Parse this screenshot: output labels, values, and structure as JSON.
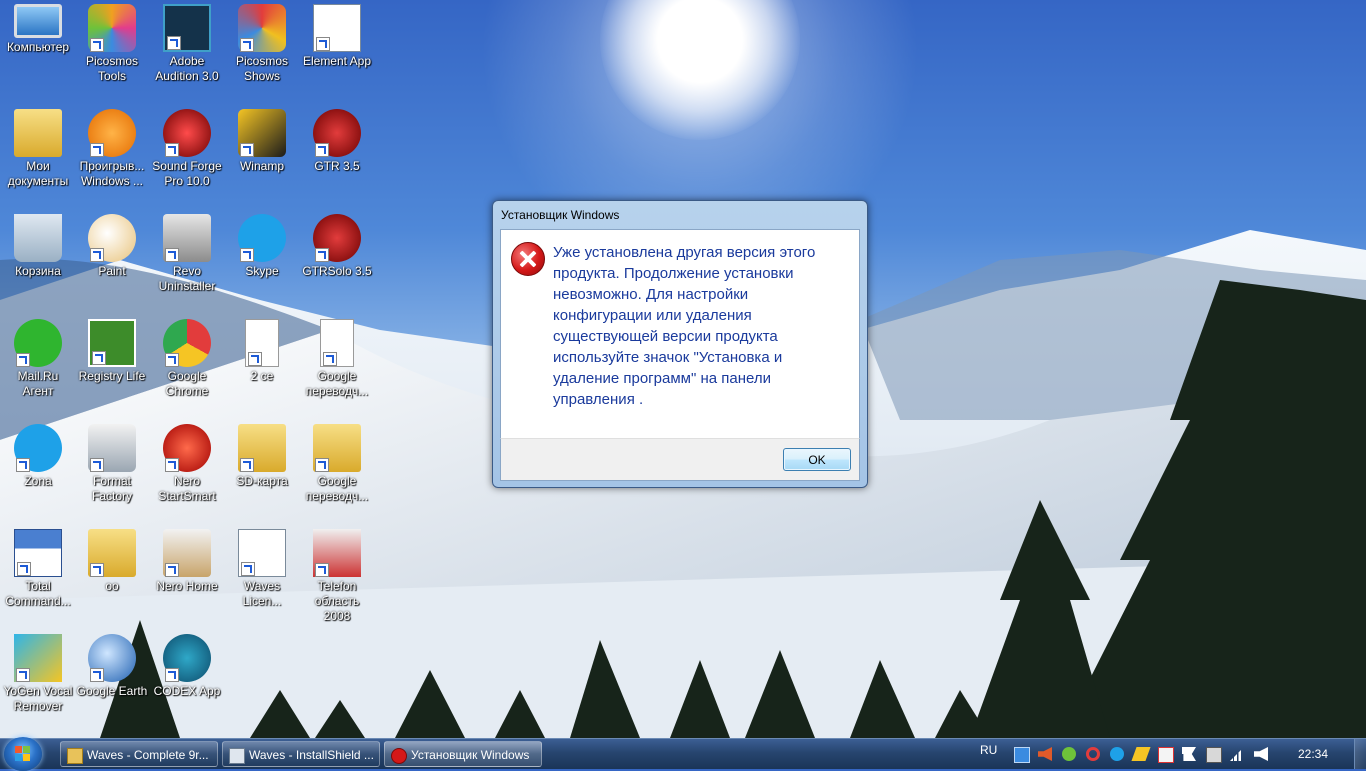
{
  "desktop": {
    "icons": [
      {
        "label": "Компьютер",
        "icon": "computer-icon"
      },
      {
        "label": "Picosmos Tools",
        "icon": "picosmos-tools-icon"
      },
      {
        "label": "Adobe Audition 3.0",
        "icon": "adobe-audition-icon"
      },
      {
        "label": "Picosmos Shows",
        "icon": "picosmos-shows-icon"
      },
      {
        "label": "Element App",
        "icon": "element-app-icon"
      },
      {
        "label": "Мои документы",
        "icon": "my-documents-icon"
      },
      {
        "label": "Проигрыв... Windows ...",
        "icon": "windows-media-player-icon"
      },
      {
        "label": "Sound Forge Pro 10.0",
        "icon": "sound-forge-icon"
      },
      {
        "label": "Winamp",
        "icon": "winamp-icon"
      },
      {
        "label": "GTR 3.5",
        "icon": "gtr-icon"
      },
      {
        "label": "Корзина",
        "icon": "recycle-bin-icon"
      },
      {
        "label": "Paint",
        "icon": "paint-icon"
      },
      {
        "label": "Revo Uninstaller",
        "icon": "revo-uninstaller-icon"
      },
      {
        "label": "Skype",
        "icon": "skype-icon"
      },
      {
        "label": "GTRSolo 3.5",
        "icon": "gtrsolo-icon"
      },
      {
        "label": "Mail.Ru Агент",
        "icon": "mailru-agent-icon"
      },
      {
        "label": "Registry Life",
        "icon": "registry-life-icon"
      },
      {
        "label": "Google Chrome",
        "icon": "chrome-icon"
      },
      {
        "label": "2 се",
        "icon": "text-file-icon"
      },
      {
        "label": "Google переводч...",
        "icon": "blank-file-icon"
      },
      {
        "label": "Zona",
        "icon": "zona-icon"
      },
      {
        "label": "Format Factory",
        "icon": "format-factory-icon"
      },
      {
        "label": "Nero StartSmart",
        "icon": "nero-startsmart-icon"
      },
      {
        "label": "SD-карта",
        "icon": "folder-icon"
      },
      {
        "label": "Google переводч...",
        "icon": "folder-icon"
      },
      {
        "label": "Total Command...",
        "icon": "total-commander-icon"
      },
      {
        "label": "оо",
        "icon": "folder-icon"
      },
      {
        "label": "Nero Home",
        "icon": "nero-home-icon"
      },
      {
        "label": "Waves Licen...",
        "icon": "waves-license-icon"
      },
      {
        "label": "Telefon область 2008",
        "icon": "telefon-icon"
      },
      {
        "label": "YoGen Vocal Remover",
        "icon": "yogen-icon"
      },
      {
        "label": "Google Earth",
        "icon": "google-earth-icon"
      },
      {
        "label": "CODEX App",
        "icon": "codex-app-icon"
      }
    ]
  },
  "dialog": {
    "title": "Установщик Windows",
    "message": "Уже установлена другая версия этого продукта.  Продолжение установки невозможно.  Для настройки конфигурации или удаления существующей версии продукта используйте значок \"Установка и удаление программ\" на панели управления .",
    "ok_label": "OK"
  },
  "taskbar": {
    "tasks": [
      {
        "label": "Waves - Complete 9r..."
      },
      {
        "label": "Waves - InstallShield ..."
      },
      {
        "label": "Установщик Windows"
      }
    ],
    "language": "RU",
    "clock": "22:34"
  }
}
